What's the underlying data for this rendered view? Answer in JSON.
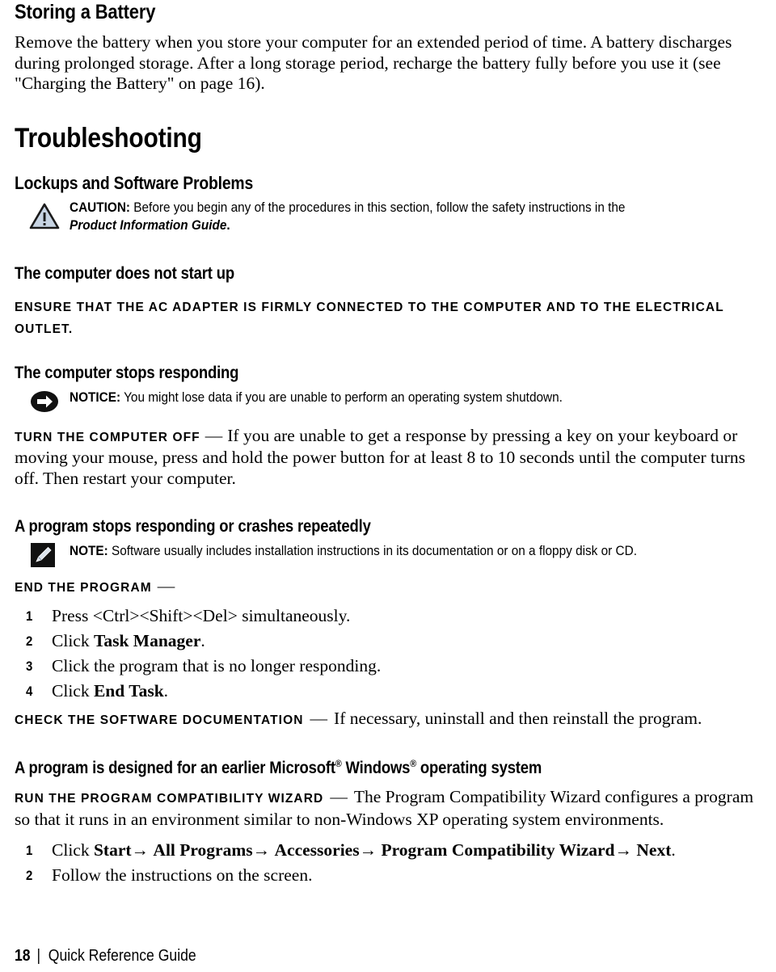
{
  "document": {
    "footer": {
      "page_number": "18",
      "separator": "|",
      "title": "Quick Reference Guide"
    }
  },
  "sections": {
    "storing_battery": {
      "heading": "Storing a Battery",
      "paragraph": "Remove the battery when you store your computer for an extended period of time. A battery discharges during prolonged storage. After a long storage period, recharge the battery fully before you use it (see \"Charging the Battery\" on page 16)."
    },
    "troubleshooting": {
      "heading": "Troubleshooting",
      "subheading": "Lockups and Software Problems",
      "caution": {
        "icon": "warning-triangle-icon",
        "label": "CAUTION:",
        "text": "Before you begin any of the procedures in this section, follow the safety instructions in the",
        "italic_ref": "Product Information Guide",
        "trailing": "."
      }
    },
    "no_start": {
      "heading": "The computer does not start up",
      "lead_in": "Ensure that the AC adapter is firmly connected to the computer and to the electrical outlet."
    },
    "stops_responding": {
      "heading": "The computer stops responding",
      "notice": {
        "icon": "notice-arrow-icon",
        "label": "NOTICE:",
        "text": "You might lose data if you are unable to perform an operating system shutdown."
      },
      "lead_in": "Turn the computer off",
      "dash": "—",
      "body": "If you are unable to get a response by pressing a key on your keyboard or moving your mouse, press and hold the power button for at least 8 to 10 seconds until the computer turns off. Then restart your computer."
    },
    "program_crashes": {
      "heading": "A program stops responding or crashes repeatedly",
      "note": {
        "icon": "note-pencil-icon",
        "label": "NOTE:",
        "text": "Software usually includes installation instructions in its documentation or on a floppy disk or CD."
      },
      "lead_in": "End the program",
      "dash": "—",
      "steps": [
        {
          "num": "1",
          "pre": "Press <Ctrl><Shift><Del> simultaneously.",
          "bold": "",
          "post": ""
        },
        {
          "num": "2",
          "pre": "Click ",
          "bold": "Task Manager",
          "post": "."
        },
        {
          "num": "3",
          "pre": "Click the program that is no longer responding.",
          "bold": "",
          "post": ""
        },
        {
          "num": "4",
          "pre": "Click ",
          "bold": "End Task",
          "post": "."
        }
      ],
      "check_docs": {
        "lead_in": "Check the software documentation",
        "dash": "—",
        "body": "If necessary, uninstall and then reinstall the program."
      }
    },
    "earlier_windows": {
      "heading_part1": "A program is designed for an earlier Microsoft",
      "reg1": "®",
      "heading_part2": " Windows",
      "reg2": "®",
      "heading_part3": " operating system",
      "lead_in": "Run the Program Compatibility Wizard",
      "dash": "—",
      "body": "The Program Compatibility Wizard configures a program so that it runs in an environment similar to non-Windows XP operating system environments.",
      "steps": [
        {
          "num": "1",
          "prefix": "Click ",
          "path": [
            "Start",
            "All Programs",
            "Accessories",
            "Program Compatibility Wizard",
            "Next"
          ],
          "arrow": "→",
          "suffix": "."
        },
        {
          "num": "2",
          "prefix": "Follow the instructions on the screen.",
          "path": [],
          "arrow": "",
          "suffix": ""
        }
      ]
    }
  },
  "colors": {
    "text": "#000000",
    "background": "#ffffff",
    "caution_icon_fill": "#c7d4e3",
    "caution_icon_stroke": "#1a1a1a",
    "notice_icon_fill": "#111111",
    "note_icon_fill": "#111111",
    "note_pencil_fill": "#dbe3ec"
  }
}
